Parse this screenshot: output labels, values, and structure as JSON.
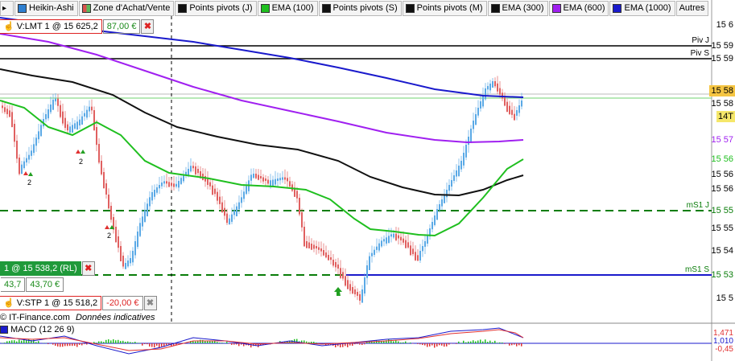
{
  "toolbar": {
    "items": [
      {
        "label": "Heikin-Ashi",
        "color": "#2e7fd0"
      },
      {
        "label": "Zone d'Achat/Vente",
        "color": "#d9534f"
      },
      {
        "label": "Points pivots (J)",
        "color": "#111111"
      },
      {
        "label": "EMA (100)",
        "color": "#1fbf1f"
      },
      {
        "label": "Points pivots (S)",
        "color": "#111111"
      },
      {
        "label": "Points pivots (M)",
        "color": "#111111"
      },
      {
        "label": "EMA (300)",
        "color": "#111111"
      },
      {
        "label": "EMA (600)",
        "color": "#a020f0"
      },
      {
        "label": "EMA (1000)",
        "color": "#1a1acc"
      },
      {
        "label": "Autres",
        "color": ""
      }
    ]
  },
  "orders": {
    "limit": {
      "label": "V:LMT  1 @ 15 625,2",
      "pnl": "87,00 €"
    },
    "stop": {
      "label": "V:STP  1 @ 15 518,2",
      "pnl": "-20,00 €"
    },
    "position": {
      "label": "1 @ 15 538,2 (RL)",
      "value1": "43,7",
      "value2": "43,70 €"
    }
  },
  "price_axis": {
    "labels": [
      "15 6",
      "15 59",
      "15 59",
      "15 58",
      "15 58",
      "14T",
      "15 57",
      "15 56",
      "15 56",
      "15 56",
      "15 55",
      "15 55",
      "15 54",
      "15 53",
      "15 5"
    ],
    "current_price_badge": "15 58"
  },
  "levels": {
    "piv_j": "Piv J",
    "piv_s": "Piv S",
    "ms1_j": "mS1 J",
    "ms1_s": "mS1 S"
  },
  "signals": {
    "marker_count": "2"
  },
  "footer": {
    "source": "© IT-Finance.com",
    "note": "Données indicatives"
  },
  "macd": {
    "label": "MACD (12 26 9)",
    "axis_labels": [
      "1,471",
      "1,010",
      "-0,45"
    ]
  },
  "colors": {
    "ema100": "#1fbf1f",
    "ema300": "#111111",
    "ema600": "#a020f0",
    "ema1000": "#1a1acc",
    "candle_up": "#5aa9e6",
    "candle_down": "#e06060",
    "pivot_dash": "#0a7d0a"
  }
}
